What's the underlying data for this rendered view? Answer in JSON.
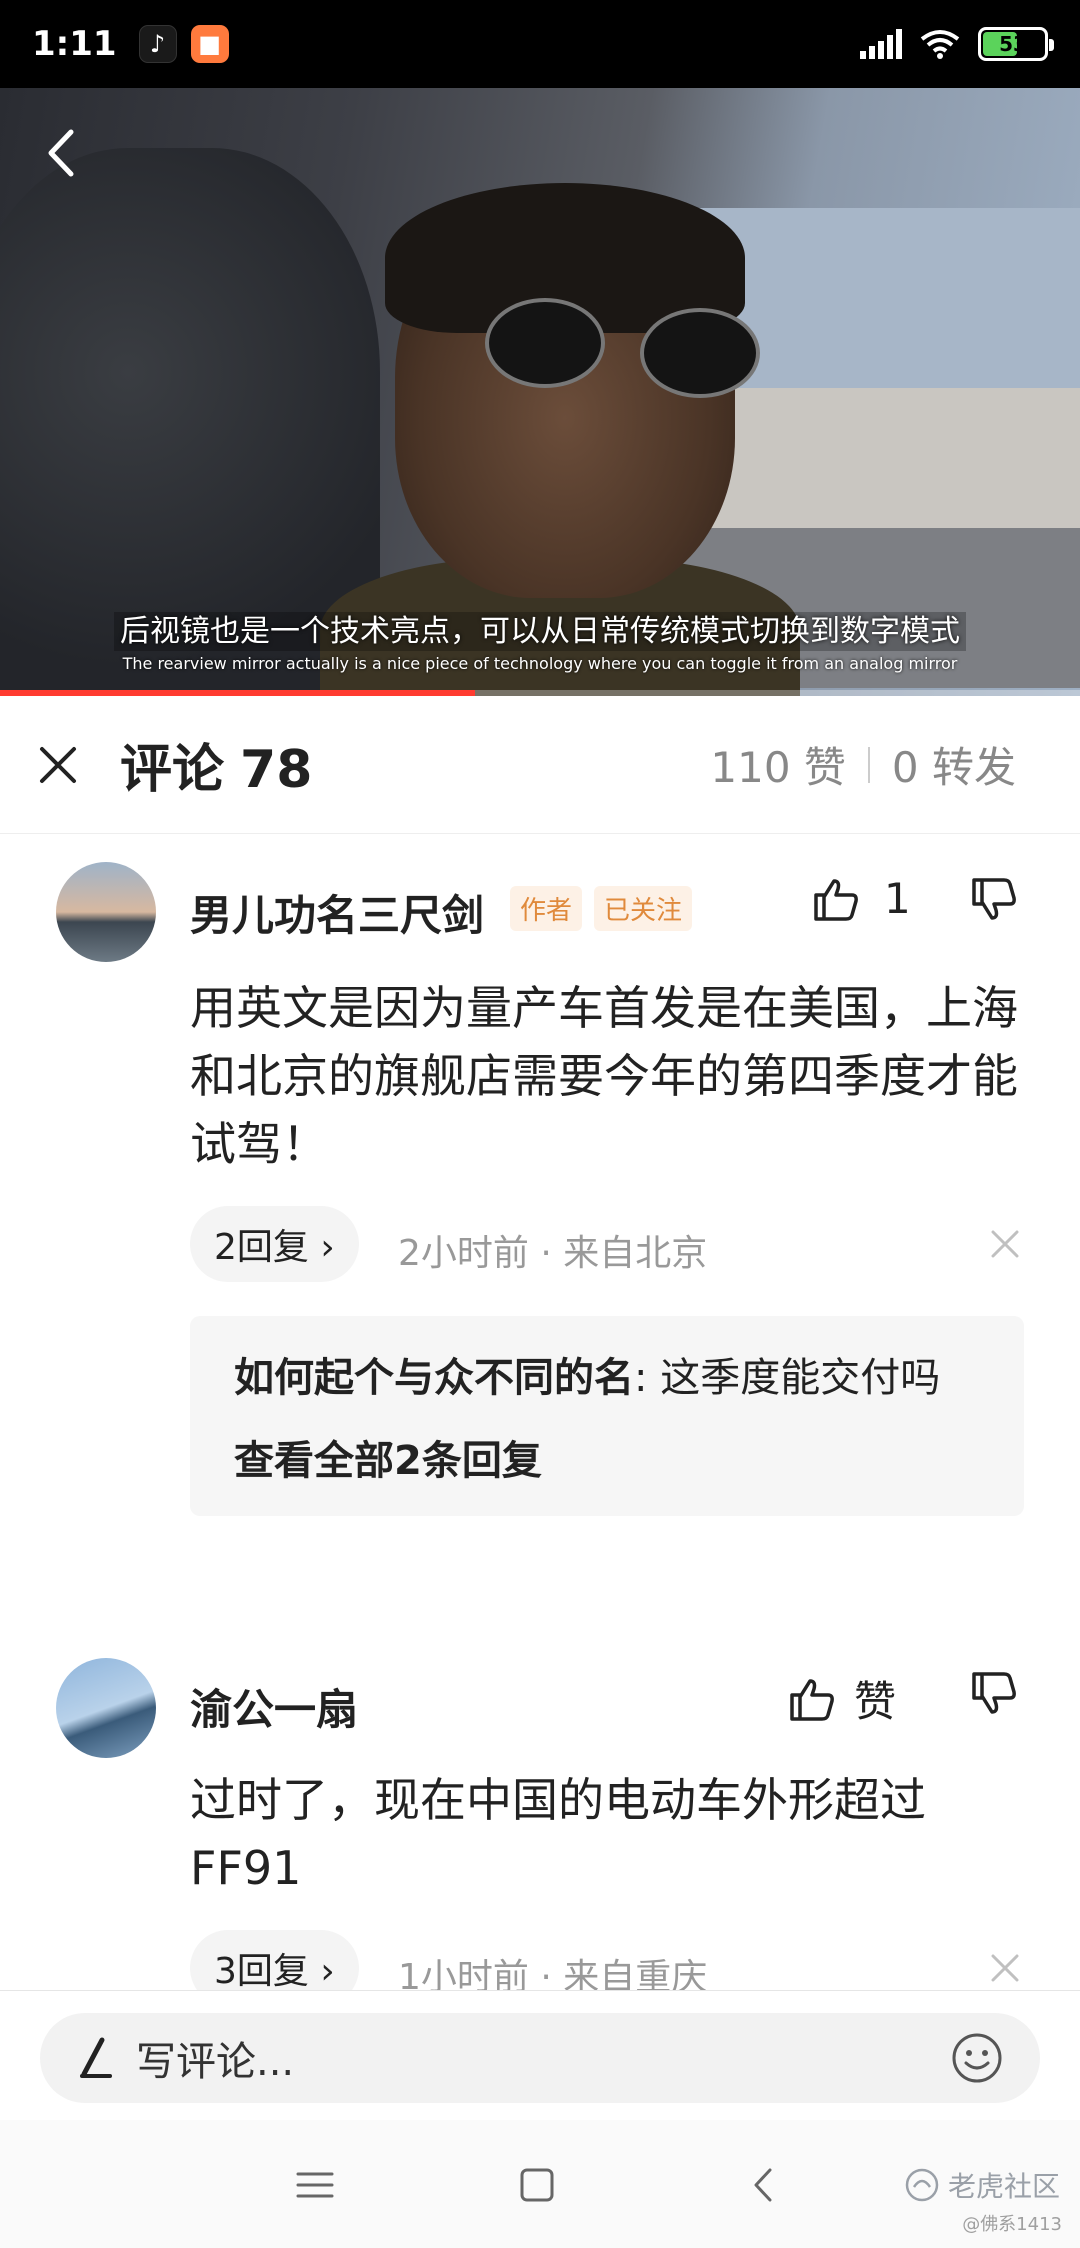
{
  "status_bar": {
    "time": "1:11",
    "battery": "53"
  },
  "video": {
    "subtitle_zh": "后视镜也是一个技术亮点，可以从日常传统模式切换到数字模式",
    "subtitle_en": "The rearview mirror actually is a nice piece of technology where you can toggle it from an analog mirror",
    "progress": 0.44
  },
  "comment_header": {
    "title": "评论",
    "count": "78",
    "likes": "110 赞",
    "shares": "0 转发"
  },
  "comments": [
    {
      "username": "男儿功名三尺剑",
      "tag_author": "作者",
      "tag_follow": "已关注",
      "like_count": "1",
      "text": "用英文是因为量产车首发是在美国，上海和北京的旗舰店需要今年的第四季度才能试驾！",
      "reply_count": "2回复 ›",
      "meta": "2小时前 · 来自北京",
      "reply": {
        "user": "如何起个与众不同的名",
        "text": ": 这季度能交付吗",
        "view_all": "查看全部2条回复"
      }
    },
    {
      "username": "渝公一扇",
      "like_label": "赞",
      "text": "过时了，现在中国的电动车外形超过FF91",
      "reply_count": "3回复 ›",
      "meta": "1小时前 · 来自重庆"
    }
  ],
  "input": {
    "placeholder": "写评论..."
  },
  "watermark": {
    "brand": "老虎社区",
    "sub": "@佛系1413"
  }
}
